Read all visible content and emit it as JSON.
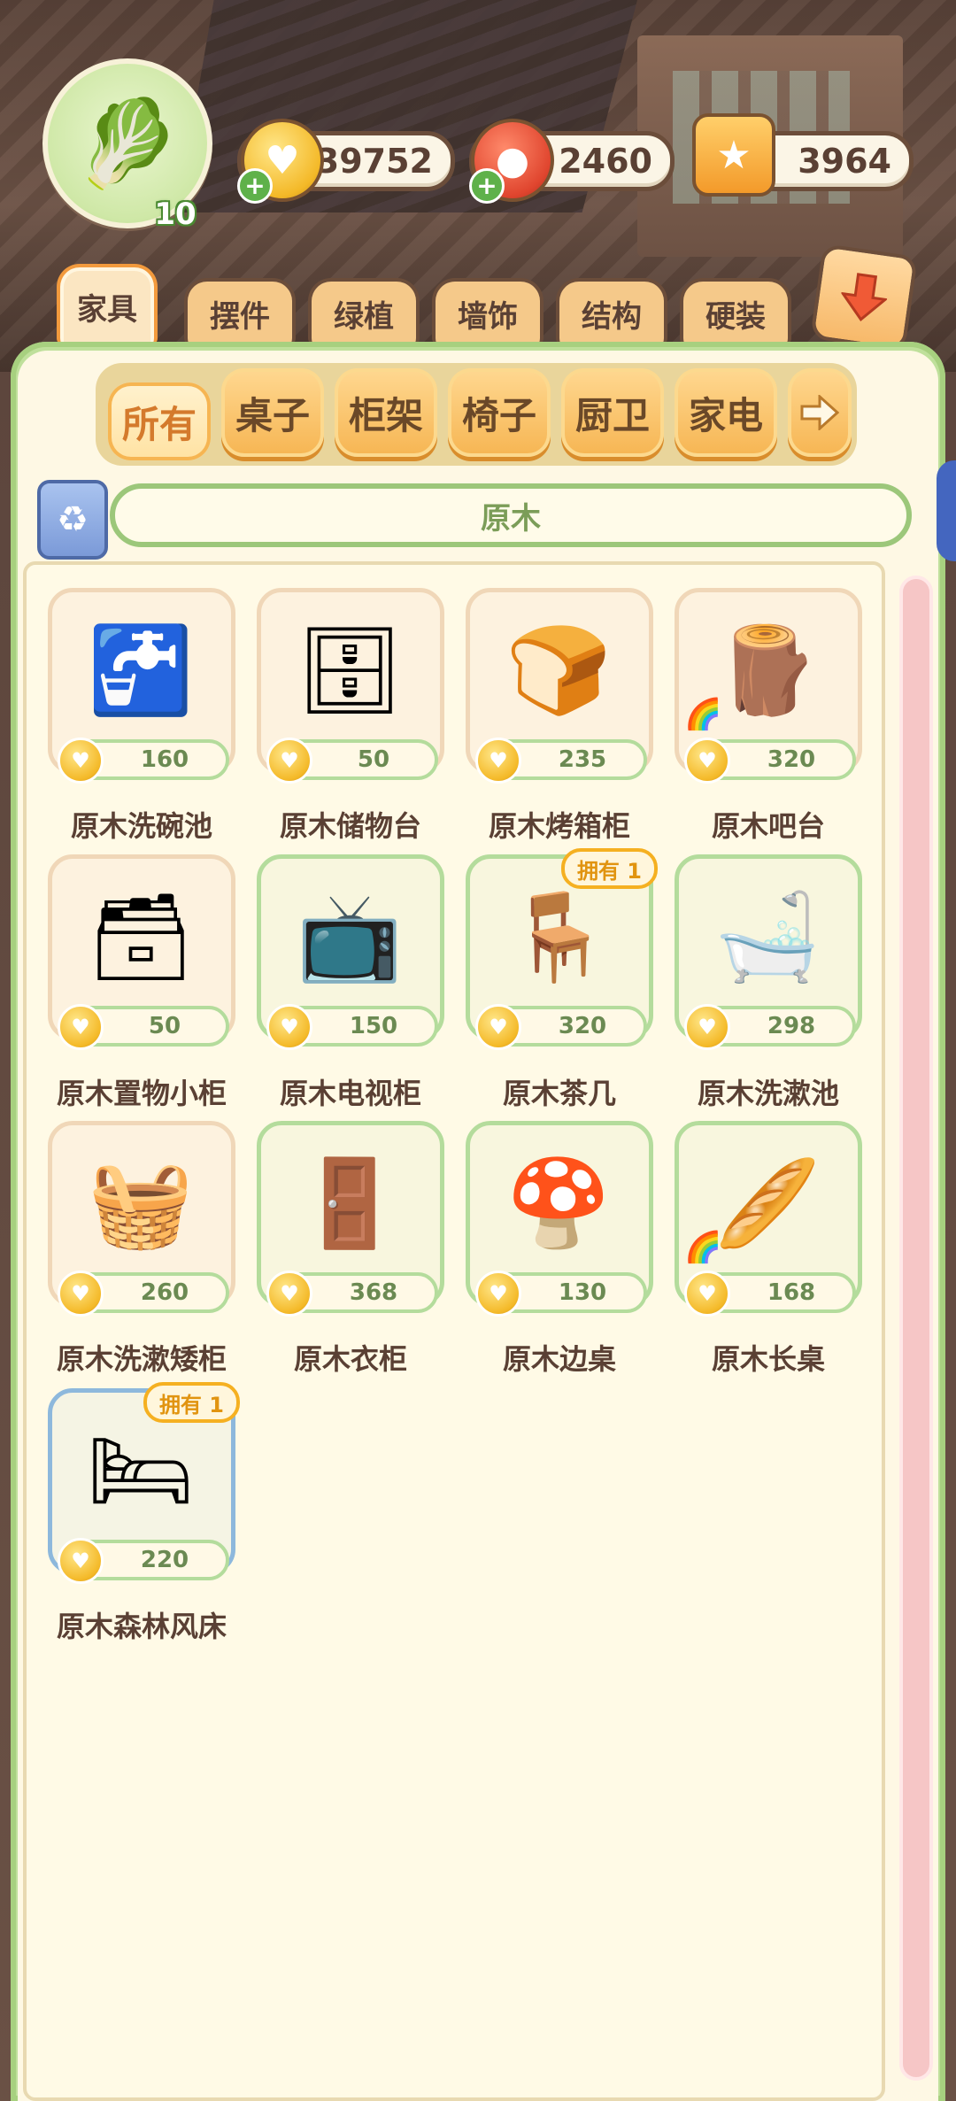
{
  "player": {
    "avatar_icon": "vegetable-sprite-avatar",
    "level": "10"
  },
  "currencies": [
    {
      "name": "coins",
      "icon": "heart-coin-icon",
      "value": "39752",
      "has_plus": true
    },
    {
      "name": "cherries",
      "icon": "cherry-icon",
      "value": "2460",
      "has_plus": true
    },
    {
      "name": "tokens",
      "icon": "badge-token-icon",
      "value": "3964",
      "has_plus": false
    }
  ],
  "category_tabs": [
    "家具",
    "摆件",
    "绿植",
    "墙饰",
    "结构",
    "硬装"
  ],
  "active_category": "家具",
  "sub_tabs": [
    "所有",
    "桌子",
    "柜架",
    "椅子",
    "厨卫",
    "家电"
  ],
  "active_sub_tab": "所有",
  "filter": {
    "label": "原木"
  },
  "items": [
    {
      "name": "原木洗碗池",
      "price": "160",
      "owned": ""
    },
    {
      "name": "原木储物台",
      "price": "50",
      "owned": ""
    },
    {
      "name": "原木烤箱柜",
      "price": "235",
      "owned": ""
    },
    {
      "name": "原木吧台",
      "price": "320",
      "owned": ""
    },
    {
      "name": "原木置物小柜",
      "price": "50",
      "owned": ""
    },
    {
      "name": "原木电视柜",
      "price": "150",
      "owned": ""
    },
    {
      "name": "原木茶几",
      "price": "320",
      "owned": "拥有 1"
    },
    {
      "name": "原木洗漱池",
      "price": "298",
      "owned": ""
    },
    {
      "name": "原木洗漱矮柜",
      "price": "260",
      "owned": ""
    },
    {
      "name": "原木衣柜",
      "price": "368",
      "owned": ""
    },
    {
      "name": "原木边桌",
      "price": "130",
      "owned": ""
    },
    {
      "name": "原木长桌",
      "price": "168",
      "owned": ""
    },
    {
      "name": "原木森林风床",
      "price": "220",
      "owned": "拥有 1"
    }
  ],
  "colors": {
    "panel_green": "#bfe09b",
    "chip_orange": "#f6b552",
    "owned_badge": "#f5b021",
    "price_text": "#6b8a52"
  }
}
